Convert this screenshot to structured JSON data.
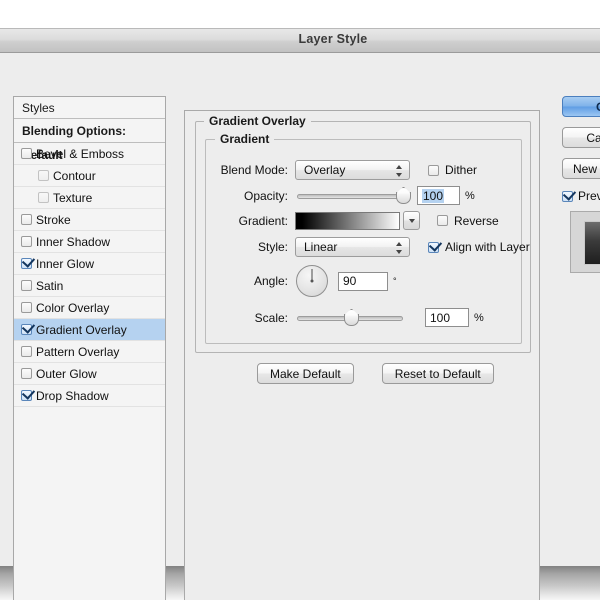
{
  "window": {
    "title": "Layer Style"
  },
  "styles_panel": {
    "header": "Styles",
    "blending_options": "Blending Options: Default",
    "effects": [
      {
        "label": "Bevel & Emboss",
        "checked": false,
        "indent": false,
        "selected": false
      },
      {
        "label": "Contour",
        "checked": false,
        "indent": true,
        "selected": false
      },
      {
        "label": "Texture",
        "checked": false,
        "indent": true,
        "selected": false
      },
      {
        "label": "Stroke",
        "checked": false,
        "indent": false,
        "selected": false
      },
      {
        "label": "Inner Shadow",
        "checked": false,
        "indent": false,
        "selected": false
      },
      {
        "label": "Inner Glow",
        "checked": true,
        "indent": false,
        "selected": false
      },
      {
        "label": "Satin",
        "checked": false,
        "indent": false,
        "selected": false
      },
      {
        "label": "Color Overlay",
        "checked": false,
        "indent": false,
        "selected": false
      },
      {
        "label": "Gradient Overlay",
        "checked": true,
        "indent": false,
        "selected": true
      },
      {
        "label": "Pattern Overlay",
        "checked": false,
        "indent": false,
        "selected": false
      },
      {
        "label": "Outer Glow",
        "checked": false,
        "indent": false,
        "selected": false
      },
      {
        "label": "Drop Shadow",
        "checked": true,
        "indent": false,
        "selected": false
      }
    ]
  },
  "main_panel": {
    "group_title": "Gradient Overlay",
    "subgroup_title": "Gradient",
    "blend_mode": {
      "label": "Blend Mode:",
      "value": "Overlay"
    },
    "opacity": {
      "label": "Opacity:",
      "value": "100",
      "unit": "%",
      "percent": 100
    },
    "gradient": {
      "label": "Gradient:",
      "start_color": "#000000",
      "end_color": "#ffffff"
    },
    "style": {
      "label": "Style:",
      "value": "Linear"
    },
    "angle": {
      "label": "Angle:",
      "value": "90",
      "unit": "°"
    },
    "scale": {
      "label": "Scale:",
      "value": "100",
      "unit": "%",
      "percent": 50
    },
    "dither": {
      "label": "Dither",
      "checked": false
    },
    "reverse": {
      "label": "Reverse",
      "checked": false
    },
    "align_with_layer": {
      "label": "Align with Layer",
      "checked": true
    },
    "make_default": "Make Default",
    "reset_to_default": "Reset to Default"
  },
  "actions": {
    "ok": "OK",
    "cancel": "Cancel",
    "new_style": "New Style...",
    "preview": {
      "label": "Preview",
      "checked": true
    }
  },
  "colors": {
    "selection_blue": "#b5d2f0",
    "panel_bg": "#ededed",
    "list_bg": "#f4f4f4",
    "primary_button": "#5f9de4"
  }
}
